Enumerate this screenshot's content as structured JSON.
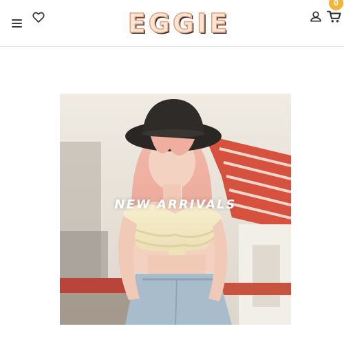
{
  "header": {
    "logo_text": "EGGIE",
    "menu_icon": "hamburger-menu-icon",
    "wishlist_icon": "heart-icon",
    "account_icon": "user-icon",
    "cart_icon": "shopping-cart-icon",
    "cart_count": "0"
  },
  "hero": {
    "title": "NEW ARRIVALS"
  },
  "colors": {
    "badge": "#f2b43a",
    "logo_fill": "#fbe6d6",
    "logo_outline": "#e7a07a",
    "header_border": "#e4e4e4"
  }
}
